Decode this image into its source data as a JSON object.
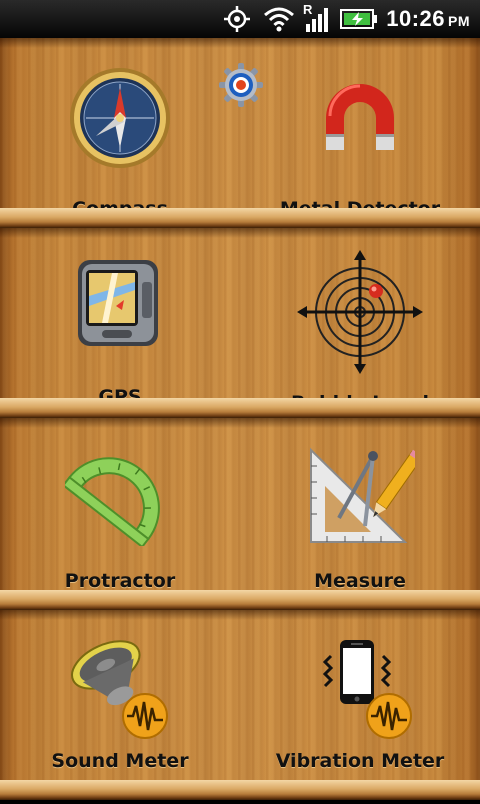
{
  "status_bar": {
    "time": "10:26",
    "ampm": "PM",
    "icons": [
      "gps-target-icon",
      "wifi-icon",
      "signal-roaming-icon",
      "battery-charging-icon"
    ],
    "roaming_letter": "R"
  },
  "settings": {
    "icon": "gear-icon"
  },
  "shelves": [
    {
      "items": [
        {
          "label": "Compass",
          "icon": "compass-icon"
        },
        {
          "label": "Metal Detector",
          "icon": "magnet-icon"
        }
      ]
    },
    {
      "items": [
        {
          "label": "GPS",
          "icon": "gps-device-icon"
        },
        {
          "label": "Bubble Level",
          "icon": "target-level-icon"
        }
      ]
    },
    {
      "items": [
        {
          "label": "Protractor",
          "icon": "protractor-icon"
        },
        {
          "label": "Measure",
          "icon": "drafting-tools-icon"
        }
      ]
    },
    {
      "items": [
        {
          "label": "Sound Meter",
          "icon": "speaker-icon"
        },
        {
          "label": "Vibration Meter",
          "icon": "vibrating-phone-icon"
        }
      ]
    }
  ],
  "colors": {
    "wood": "#cf9247",
    "ledge": "#e8c287",
    "label": "#111111"
  }
}
